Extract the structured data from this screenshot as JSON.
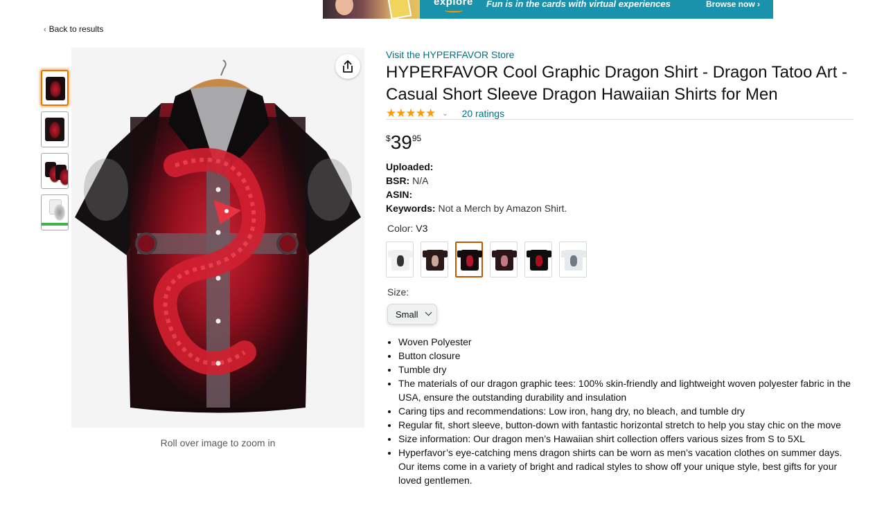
{
  "banner": {
    "logo_text": "explore",
    "headline": "Fun is in the cards with virtual experiences",
    "cta": "Browse now ›"
  },
  "nav": {
    "back_label": "Back to results"
  },
  "gallery": {
    "thumbnails": [
      "thumbnail-1",
      "thumbnail-2",
      "thumbnail-3",
      "thumbnail-4"
    ],
    "active_index": 0,
    "zoom_hint": "Roll over image to zoom in"
  },
  "product": {
    "store_link": "Visit the HYPERFAVOR Store",
    "title": "HYPERFAVOR Cool Graphic Dragon Shirt - Dragon Tatoo Art - Casual Short Sleeve Dragon Hawaiian Shirts for Men",
    "stars": "★★★★★",
    "rating_value": 5,
    "ratings_count": "20 ratings",
    "price": {
      "symbol": "$",
      "whole": "39",
      "fraction": "95"
    },
    "details": {
      "uploaded_label": "Uploaded:",
      "uploaded_value": "",
      "bsr_label": "BSR:",
      "bsr_value": "N/A",
      "asin_label": "ASIN:",
      "asin_value": "",
      "keywords_label": "Keywords:",
      "keywords_value": "Not a Merch by Amazon Shirt."
    },
    "color_label": "Color:",
    "color_value": "V3",
    "color_swatches": [
      {
        "shirt": "#f1f1f1",
        "print": "#333333"
      },
      {
        "shirt": "#2a1a1a",
        "print": "#c9a89a"
      },
      {
        "shirt": "#140b0e",
        "print": "#b3182a"
      },
      {
        "shirt": "#2b1518",
        "print": "#c37a83"
      },
      {
        "shirt": "#0e0e0e",
        "print": "#a80f1b"
      },
      {
        "shirt": "#e7eaec",
        "print": "#6f7a86"
      }
    ],
    "selected_swatch": 2,
    "size_label": "Size:",
    "size_value": "Small",
    "bullets": [
      "Woven Polyester",
      "Button closure",
      "Tumble dry",
      "The materials of our dragon graphic tees: 100% skin-friendly and lightweight woven polyester fabric in the USA, ensure the outstanding durability and insulation",
      "Caring tips and recommendations: Low iron, hang dry, no bleach, and tumble dry",
      "Regular fit, short sleeve, button-down with fantastic horizontal stretch to help you stay chic on the move",
      "Size information: Our dragon men’s Hawaiian shirt collection offers various sizes from S to 5XL",
      "Hyperfavor’s eye-catching mens dragon shirts can be worn as men’s vacation clothes on summer days. Our items come in a variety of bright and radical styles to show off your unique style, best gifts for your loved gentlemen."
    ]
  },
  "colors": {
    "link": "#007185",
    "star": "#ff9a00",
    "active_thumb": "#e77600"
  }
}
